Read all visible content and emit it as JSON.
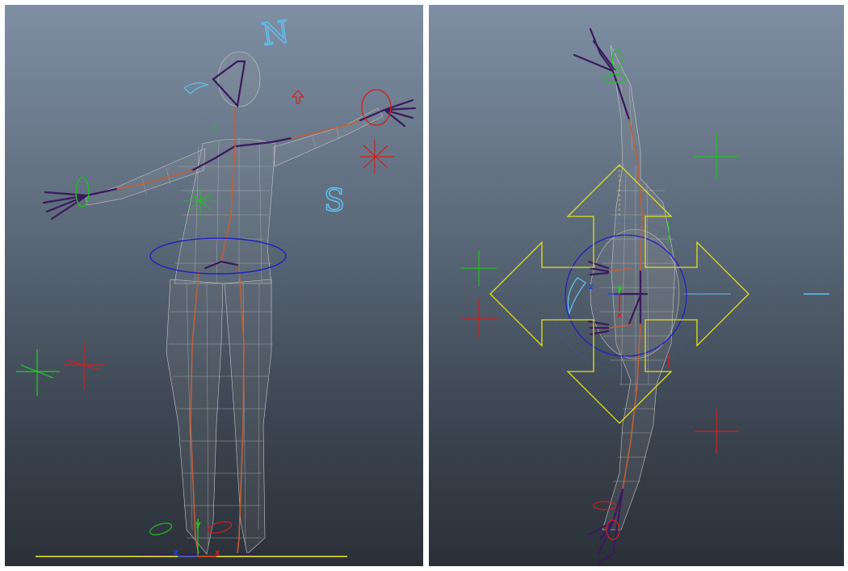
{
  "viewports": {
    "left": {
      "view": "front",
      "compass_north": "N",
      "compass_south": "S",
      "axis": {
        "x": "x",
        "y": "y",
        "z": "z"
      }
    },
    "right": {
      "view": "top",
      "axis": {
        "x": "x",
        "y": "y",
        "z": "z"
      }
    }
  },
  "colors": {
    "mesh_wire": "#c8c8c8",
    "joint_dark": "#3a1a5c",
    "joint_orange": "#c0603a",
    "control_blue": "#2020c0",
    "control_red": "#d02020",
    "control_green": "#20c020",
    "control_cyan": "#60c0f0",
    "move_manipulator": "#e0e020",
    "ground_line": "#f0f020"
  },
  "icons": {
    "locator": "cross-locator-icon",
    "compass": "compass-letter-icon",
    "move_tool": "move-arrows-icon"
  }
}
